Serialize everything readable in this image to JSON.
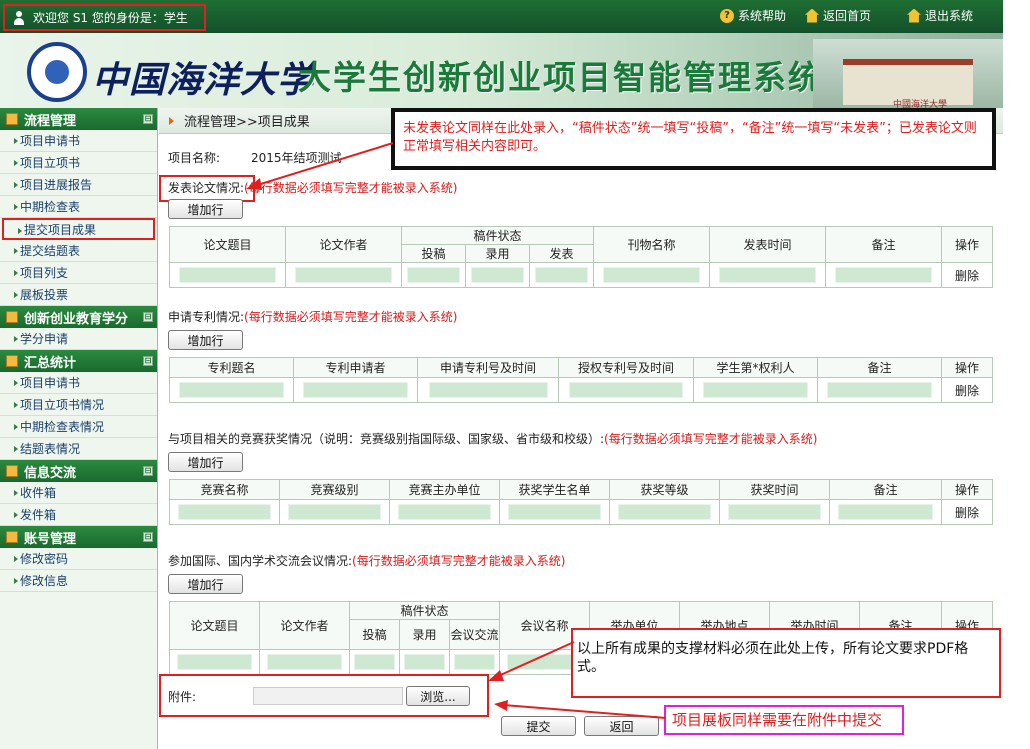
{
  "topbar": {
    "welcome": "欢迎您 S1 您的身份是：学生",
    "help": "系统帮助",
    "home": "返回首页",
    "logout": "退出系统"
  },
  "banner": {
    "university": "中国海洋大学",
    "title": "大学生创新创业项目智能管理系统"
  },
  "sidebar": {
    "groups": [
      {
        "label": "流程管理",
        "items": [
          "项目申请书",
          "项目立项书",
          "项目进展报告",
          "中期检查表",
          "提交项目成果",
          "提交结题表",
          "项目列支",
          "展板投票"
        ]
      },
      {
        "label": "创新创业教育学分",
        "items": [
          "学分申请"
        ]
      },
      {
        "label": "汇总统计",
        "items": [
          "项目申请书",
          "项目立项书情况",
          "中期检查表情况",
          "结题表情况"
        ]
      },
      {
        "label": "信息交流",
        "items": [
          "收件箱",
          "发件箱"
        ]
      },
      {
        "label": "账号管理",
        "items": [
          "修改密码",
          "修改信息"
        ]
      }
    ],
    "toggle": "⊟"
  },
  "main": {
    "breadcrumb": "流程管理>>项目成果",
    "project_label": "项目名称:",
    "project_name": "2015年结项测试",
    "required_note": "(每行数据必须填写完整才能被录入系统)",
    "add_button": "增加行",
    "delete": "删除",
    "papers": {
      "title": "发表论文情况:",
      "headers": [
        "论文题目",
        "论文作者",
        "稿件状态",
        "刊物名称",
        "发表时间",
        "备注",
        "操作"
      ],
      "status_sub": [
        "投稿",
        "录用",
        "发表"
      ]
    },
    "patents": {
      "title": "申请专利情况:",
      "headers": [
        "专利题名",
        "专利申请者",
        "申请专利号及时间",
        "授权专利号及时间",
        "学生第*权利人",
        "备注",
        "操作"
      ]
    },
    "awards": {
      "title": "与项目相关的竞赛获奖情况（说明：竞赛级别指国际级、国家级、省市级和校级）:",
      "headers": [
        "竞赛名称",
        "竞赛级别",
        "竞赛主办单位",
        "获奖学生名单",
        "获奖等级",
        "获奖时间",
        "备注",
        "操作"
      ]
    },
    "conferences": {
      "title": "参加国际、国内学术交流会议情况:",
      "headers": [
        "论文题目",
        "论文作者",
        "稿件状态",
        "会议名称",
        "举办单位",
        "举办地点",
        "举办时间",
        "备注",
        "操作"
      ],
      "status_sub": [
        "投稿",
        "录用",
        "会议交流"
      ]
    },
    "attachment_label": "附件:",
    "browse_button": "浏览...",
    "submit_button": "提交",
    "back_button": "返回"
  },
  "annotations": {
    "paper_note": "未发表论文同样在此处录入，“稿件状态”统一填写“投稿”，“备注”统一填写“未发表”；已发表论文则正常填写相关内容即可。",
    "attachment_note": "以上所有成果的支撑材料必须在此处上传，所有论文要求PDF格式。",
    "board_note": "项目展板同样需要在附件中提交"
  },
  "colors": {
    "accent_green": "#1a6a2e",
    "annotation_red": "#e02020",
    "annotation_magenta": "#e020e0",
    "input_green": "#cfe8d2"
  }
}
